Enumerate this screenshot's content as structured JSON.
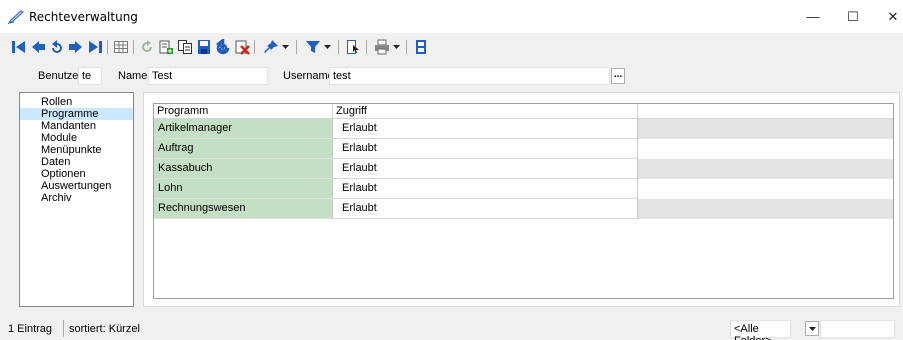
{
  "window": {
    "title": "Rechteverwaltung",
    "minimize": "—",
    "maximize": "☐",
    "close": "✕"
  },
  "toolbar": {
    "icons": [
      "first-record-icon",
      "prev-record-icon",
      "undo-icon",
      "next-record-icon",
      "last-record-icon",
      "grid-view-icon",
      "refresh-icon",
      "new-record-icon",
      "copy-record-icon",
      "save-icon",
      "cancel-edit-icon",
      "delete-icon",
      "pin-icon",
      "filter-icon",
      "page-icon",
      "print-icon",
      "save-layout-icon"
    ]
  },
  "form": {
    "benutzer_label": "Benutzer",
    "benutzer_value": "te",
    "name_label": "Name",
    "name_value": "Test",
    "username_label": "Username",
    "username_value": "test",
    "more_button": "..."
  },
  "nav": {
    "items": [
      "Rollen",
      "Programme",
      "Mandanten",
      "Module",
      "Menüpunkte",
      "Daten",
      "Optionen",
      "Auswertungen",
      "Archiv"
    ],
    "selected": "Programme"
  },
  "grid": {
    "columns": [
      "Programm",
      "Zugriff"
    ],
    "rows": [
      [
        "Artikelmanager",
        "Erlaubt"
      ],
      [
        "Auftrag",
        "Erlaubt"
      ],
      [
        "Kassabuch",
        "Erlaubt"
      ],
      [
        "Lohn",
        "Erlaubt"
      ],
      [
        "Rechnungswesen",
        "Erlaubt"
      ]
    ]
  },
  "status": {
    "count": "1 Eintrag",
    "sort": "sortiert: Kürzel",
    "field_filter": "<Alle Felder>",
    "search_value": ""
  },
  "colors": {
    "accent": "#1f5fc0",
    "row_green": "#c4dfc4",
    "selection": "#cce8ff"
  }
}
